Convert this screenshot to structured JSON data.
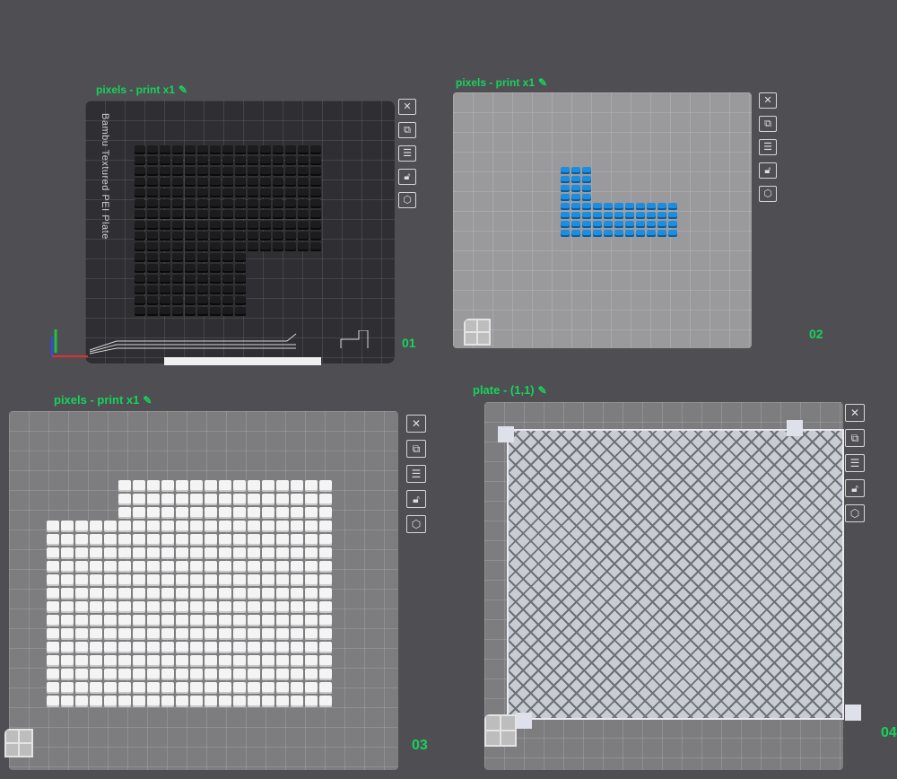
{
  "plates": [
    {
      "title": "pixels - print x1",
      "number": "01",
      "bed_label": "Bambu Textured PEI Plate"
    },
    {
      "title": "pixels - print x1",
      "number": "02"
    },
    {
      "title": "pixels - print x1",
      "number": "03"
    },
    {
      "title": "plate - (1,1)",
      "number": "04"
    }
  ],
  "toolbar_icons": [
    "close-icon",
    "arrange-icon",
    "layout-icon",
    "lock-icon",
    "settings-icon"
  ],
  "colors": {
    "accent_green": "#16d35b",
    "background": "#4f4f53",
    "pixel_black": "#1c1c1e",
    "pixel_blue": "#1d8de0",
    "pixel_white": "#f4f4f4"
  }
}
